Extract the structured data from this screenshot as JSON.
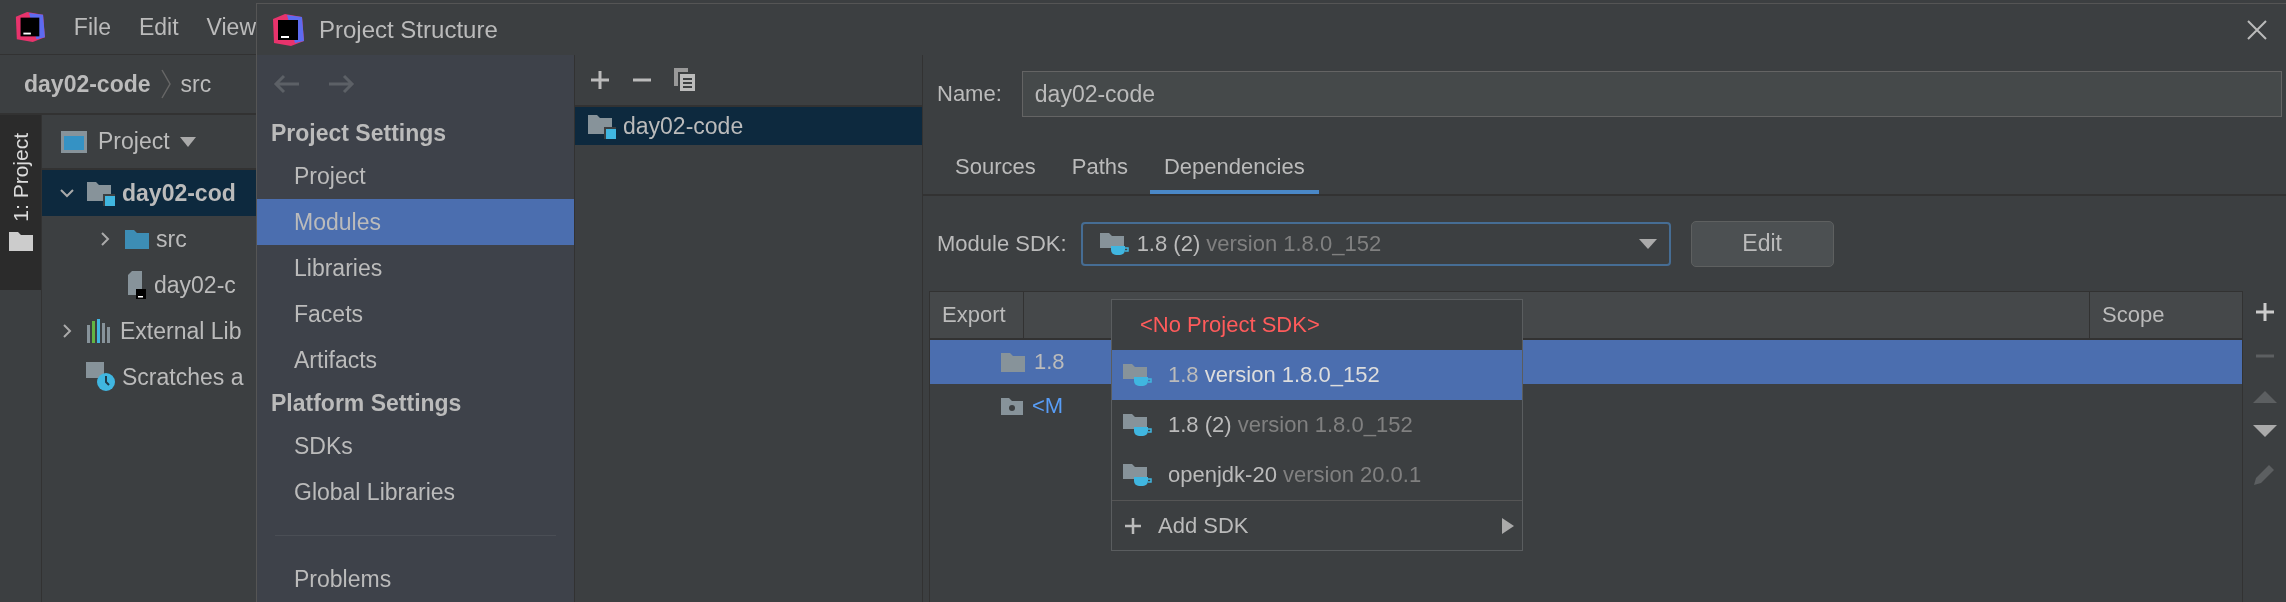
{
  "ide": {
    "menu": [
      "File",
      "Edit",
      "View"
    ],
    "breadcrumb": [
      "day02-code",
      "src"
    ],
    "tool_window_tab": "1: Project",
    "project_panel": {
      "title": "Project",
      "tree": [
        {
          "label": "day02-cod",
          "kind": "module",
          "expanded": true,
          "selected": true,
          "children": [
            {
              "label": "src",
              "kind": "folder",
              "expanded": false,
              "selected": false
            },
            {
              "label": "day02-c",
              "kind": "file",
              "selected": false
            }
          ]
        },
        {
          "label": "External Lib",
          "kind": "libraries",
          "expanded": false,
          "selected": false
        },
        {
          "label": "Scratches a",
          "kind": "scratches",
          "selected": false
        }
      ]
    }
  },
  "dialog": {
    "title": "Project Structure",
    "sidebar": [
      {
        "title": "Project Settings",
        "items": [
          {
            "label": "Project",
            "selected": false
          },
          {
            "label": "Modules",
            "selected": true
          },
          {
            "label": "Libraries",
            "selected": false
          },
          {
            "label": "Facets",
            "selected": false
          },
          {
            "label": "Artifacts",
            "selected": false
          }
        ]
      },
      {
        "title": "Platform Settings",
        "items": [
          {
            "label": "SDKs",
            "selected": false
          },
          {
            "label": "Global Libraries",
            "selected": false
          }
        ]
      },
      {
        "items": [
          {
            "label": "Problems",
            "selected": false
          }
        ]
      }
    ],
    "modules": [
      {
        "label": "day02-code",
        "selected": true
      }
    ],
    "name_field": {
      "label": "Name:",
      "value": "day02-code"
    },
    "tabs": [
      {
        "label": "Sources",
        "selected": false
      },
      {
        "label": "Paths",
        "selected": false
      },
      {
        "label": "Dependencies",
        "selected": true
      }
    ],
    "module_sdk": {
      "label": "Module SDK:",
      "name": "1.8 (2)",
      "version": "version 1.8.0_152"
    },
    "edit_button": "Edit",
    "table": {
      "columns": [
        "Export",
        "Scope"
      ],
      "rows": [
        {
          "kind": "sdk",
          "text": "1.8",
          "selected": true
        },
        {
          "kind": "source",
          "text": "<M",
          "selected": false
        }
      ]
    },
    "sdk_popup": [
      {
        "kind": "none",
        "name": "<No Project SDK>",
        "selected": false
      },
      {
        "kind": "sdk",
        "name": "1.8",
        "version": "version 1.8.0_152",
        "selected": true
      },
      {
        "kind": "sdk",
        "name": "1.8 (2)",
        "version": "version 1.8.0_152",
        "selected": false
      },
      {
        "kind": "sdk",
        "name": "openjdk-20",
        "version": "version 20.0.1",
        "selected": false
      },
      {
        "kind": "add",
        "name": "Add SDK",
        "selected": false
      }
    ]
  }
}
